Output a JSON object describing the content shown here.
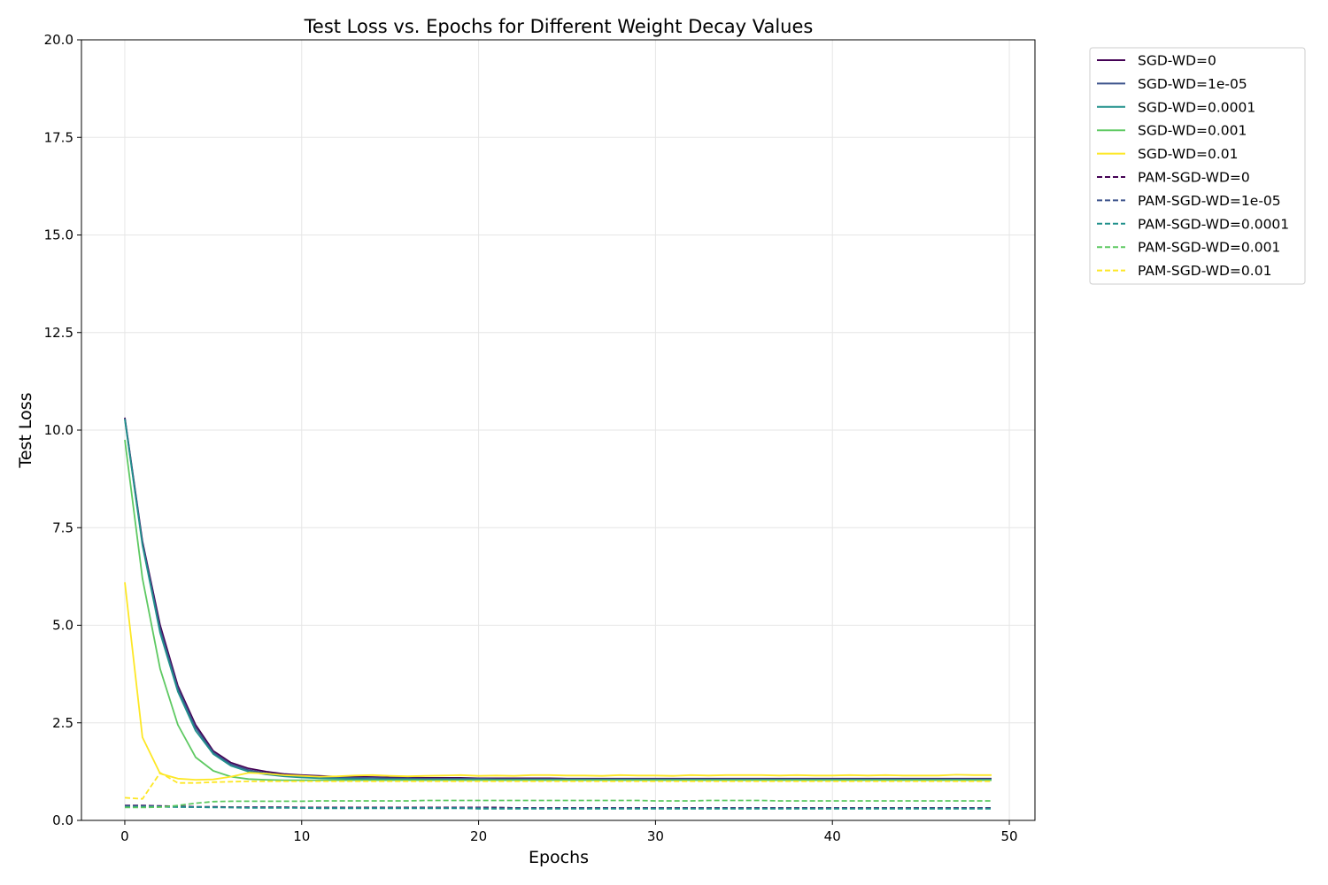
{
  "chart_data": {
    "type": "line",
    "title": "Test Loss vs. Epochs for Different Weight Decay Values",
    "xlabel": "Epochs",
    "ylabel": "Test Loss",
    "xlim": [
      -2.45,
      51.45
    ],
    "ylim": [
      0,
      20
    ],
    "xticks": [
      0,
      10,
      20,
      30,
      40,
      50
    ],
    "yticks": [
      0.0,
      2.5,
      5.0,
      7.5,
      10.0,
      12.5,
      15.0,
      17.5,
      20.0
    ],
    "ytick_labels": [
      "0.0",
      "2.5",
      "5.0",
      "7.5",
      "10.0",
      "12.5",
      "15.0",
      "17.5",
      "20.0"
    ],
    "grid": true,
    "legend_position": "outside-right-top",
    "x": [
      0,
      1,
      2,
      3,
      4,
      5,
      6,
      7,
      8,
      9,
      10,
      11,
      12,
      13,
      14,
      15,
      16,
      17,
      18,
      19,
      20,
      21,
      22,
      23,
      24,
      25,
      26,
      27,
      28,
      29,
      30,
      31,
      32,
      33,
      34,
      35,
      36,
      37,
      38,
      39,
      40,
      41,
      42,
      43,
      44,
      45,
      46,
      47,
      48,
      49
    ],
    "series": [
      {
        "name": "SGD-WD=0",
        "color": "#440154",
        "dash": "solid",
        "values": [
          10.32,
          7.15,
          5.0,
          3.45,
          2.45,
          1.78,
          1.48,
          1.33,
          1.25,
          1.19,
          1.16,
          1.14,
          1.12,
          1.12,
          1.11,
          1.1,
          1.1,
          1.09,
          1.09,
          1.09,
          1.08,
          1.08,
          1.08,
          1.08,
          1.08,
          1.07,
          1.07,
          1.07,
          1.07,
          1.07,
          1.07,
          1.07,
          1.07,
          1.07,
          1.07,
          1.07,
          1.07,
          1.07,
          1.07,
          1.07,
          1.07,
          1.07,
          1.07,
          1.07,
          1.07,
          1.07,
          1.07,
          1.07,
          1.07,
          1.07
        ]
      },
      {
        "name": "SGD-WD=1e-05",
        "color": "#3b528b",
        "dash": "solid",
        "values": [
          10.3,
          7.1,
          4.9,
          3.38,
          2.38,
          1.74,
          1.44,
          1.29,
          1.21,
          1.16,
          1.13,
          1.11,
          1.1,
          1.09,
          1.09,
          1.08,
          1.08,
          1.07,
          1.07,
          1.07,
          1.07,
          1.06,
          1.06,
          1.06,
          1.06,
          1.06,
          1.06,
          1.06,
          1.06,
          1.06,
          1.06,
          1.06,
          1.06,
          1.06,
          1.06,
          1.06,
          1.06,
          1.06,
          1.06,
          1.06,
          1.06,
          1.06,
          1.06,
          1.06,
          1.06,
          1.06,
          1.06,
          1.06,
          1.06,
          1.06
        ]
      },
      {
        "name": "SGD-WD=0.0001",
        "color": "#21918c",
        "dash": "solid",
        "values": [
          10.28,
          7.05,
          4.8,
          3.3,
          2.3,
          1.7,
          1.4,
          1.25,
          1.18,
          1.13,
          1.1,
          1.08,
          1.07,
          1.06,
          1.05,
          1.05,
          1.05,
          1.04,
          1.04,
          1.04,
          1.04,
          1.04,
          1.04,
          1.04,
          1.04,
          1.04,
          1.04,
          1.04,
          1.04,
          1.04,
          1.04,
          1.04,
          1.04,
          1.04,
          1.04,
          1.04,
          1.04,
          1.04,
          1.04,
          1.04,
          1.04,
          1.04,
          1.04,
          1.04,
          1.04,
          1.04,
          1.04,
          1.04,
          1.04,
          1.04
        ]
      },
      {
        "name": "SGD-WD=0.001",
        "color": "#5ec962",
        "dash": "solid",
        "values": [
          9.75,
          6.2,
          3.88,
          2.45,
          1.62,
          1.27,
          1.12,
          1.06,
          1.04,
          1.03,
          1.03,
          1.03,
          1.03,
          1.03,
          1.03,
          1.03,
          1.03,
          1.03,
          1.03,
          1.03,
          1.03,
          1.03,
          1.03,
          1.03,
          1.03,
          1.03,
          1.03,
          1.03,
          1.03,
          1.03,
          1.03,
          1.03,
          1.03,
          1.03,
          1.03,
          1.03,
          1.03,
          1.03,
          1.03,
          1.03,
          1.03,
          1.03,
          1.03,
          1.03,
          1.03,
          1.03,
          1.03,
          1.03,
          1.03,
          1.03
        ]
      },
      {
        "name": "SGD-WD=0.01",
        "color": "#fde725",
        "dash": "solid",
        "values": [
          6.1,
          2.13,
          1.2,
          1.07,
          1.04,
          1.05,
          1.12,
          1.22,
          1.2,
          1.16,
          1.14,
          1.12,
          1.13,
          1.15,
          1.16,
          1.14,
          1.13,
          1.14,
          1.15,
          1.16,
          1.14,
          1.15,
          1.14,
          1.16,
          1.16,
          1.15,
          1.15,
          1.14,
          1.16,
          1.15,
          1.15,
          1.14,
          1.16,
          1.15,
          1.16,
          1.16,
          1.16,
          1.15,
          1.16,
          1.15,
          1.15,
          1.16,
          1.15,
          1.16,
          1.15,
          1.15,
          1.15,
          1.17,
          1.16,
          1.16
        ]
      },
      {
        "name": "PAM-SGD-WD=0",
        "color": "#440154",
        "dash": "dashed",
        "values": [
          0.38,
          0.38,
          0.37,
          0.36,
          0.35,
          0.35,
          0.34,
          0.34,
          0.34,
          0.34,
          0.33,
          0.33,
          0.33,
          0.33,
          0.33,
          0.33,
          0.33,
          0.33,
          0.33,
          0.33,
          0.33,
          0.33,
          0.32,
          0.32,
          0.32,
          0.32,
          0.32,
          0.32,
          0.32,
          0.32,
          0.32,
          0.32,
          0.32,
          0.32,
          0.32,
          0.32,
          0.32,
          0.32,
          0.32,
          0.32,
          0.32,
          0.32,
          0.32,
          0.32,
          0.32,
          0.32,
          0.32,
          0.32,
          0.32,
          0.32
        ]
      },
      {
        "name": "PAM-SGD-WD=1e-05",
        "color": "#3b528b",
        "dash": "dashed",
        "values": [
          0.37,
          0.37,
          0.36,
          0.35,
          0.34,
          0.34,
          0.33,
          0.33,
          0.33,
          0.33,
          0.32,
          0.32,
          0.32,
          0.32,
          0.32,
          0.32,
          0.32,
          0.32,
          0.32,
          0.32,
          0.32,
          0.31,
          0.31,
          0.31,
          0.31,
          0.31,
          0.31,
          0.31,
          0.31,
          0.31,
          0.31,
          0.31,
          0.31,
          0.31,
          0.31,
          0.31,
          0.31,
          0.31,
          0.31,
          0.31,
          0.31,
          0.31,
          0.31,
          0.31,
          0.31,
          0.31,
          0.31,
          0.31,
          0.31,
          0.31
        ]
      },
      {
        "name": "PAM-SGD-WD=0.0001",
        "color": "#21918c",
        "dash": "dashed",
        "values": [
          0.35,
          0.35,
          0.35,
          0.34,
          0.34,
          0.33,
          0.33,
          0.32,
          0.32,
          0.32,
          0.32,
          0.31,
          0.31,
          0.31,
          0.31,
          0.31,
          0.31,
          0.31,
          0.31,
          0.31,
          0.3,
          0.3,
          0.3,
          0.3,
          0.3,
          0.3,
          0.3,
          0.3,
          0.3,
          0.3,
          0.3,
          0.3,
          0.3,
          0.3,
          0.3,
          0.3,
          0.3,
          0.3,
          0.3,
          0.3,
          0.3,
          0.3,
          0.3,
          0.3,
          0.3,
          0.3,
          0.3,
          0.3,
          0.3,
          0.3
        ]
      },
      {
        "name": "PAM-SGD-WD=0.001",
        "color": "#5ec962",
        "dash": "dashed",
        "values": [
          0.33,
          0.33,
          0.34,
          0.38,
          0.44,
          0.48,
          0.49,
          0.49,
          0.49,
          0.49,
          0.49,
          0.5,
          0.5,
          0.5,
          0.5,
          0.5,
          0.5,
          0.51,
          0.51,
          0.51,
          0.51,
          0.51,
          0.51,
          0.51,
          0.51,
          0.51,
          0.51,
          0.51,
          0.51,
          0.51,
          0.5,
          0.5,
          0.5,
          0.51,
          0.51,
          0.51,
          0.51,
          0.5,
          0.5,
          0.5,
          0.5,
          0.5,
          0.5,
          0.5,
          0.5,
          0.5,
          0.5,
          0.5,
          0.5,
          0.5
        ]
      },
      {
        "name": "PAM-SGD-WD=0.01",
        "color": "#fde725",
        "dash": "dashed",
        "values": [
          0.58,
          0.55,
          1.22,
          0.96,
          0.96,
          0.98,
          0.99,
          1.0,
          1.0,
          1.0,
          1.0,
          1.0,
          1.0,
          1.0,
          1.0,
          1.0,
          1.0,
          1.0,
          1.0,
          1.0,
          1.0,
          1.0,
          1.0,
          1.0,
          1.0,
          1.0,
          1.0,
          1.0,
          1.0,
          1.0,
          1.0,
          1.0,
          1.0,
          1.0,
          1.0,
          1.0,
          1.0,
          1.0,
          1.0,
          1.0,
          1.0,
          1.0,
          1.0,
          1.0,
          1.0,
          1.0,
          1.0,
          1.0,
          1.0,
          1.0
        ]
      }
    ]
  }
}
